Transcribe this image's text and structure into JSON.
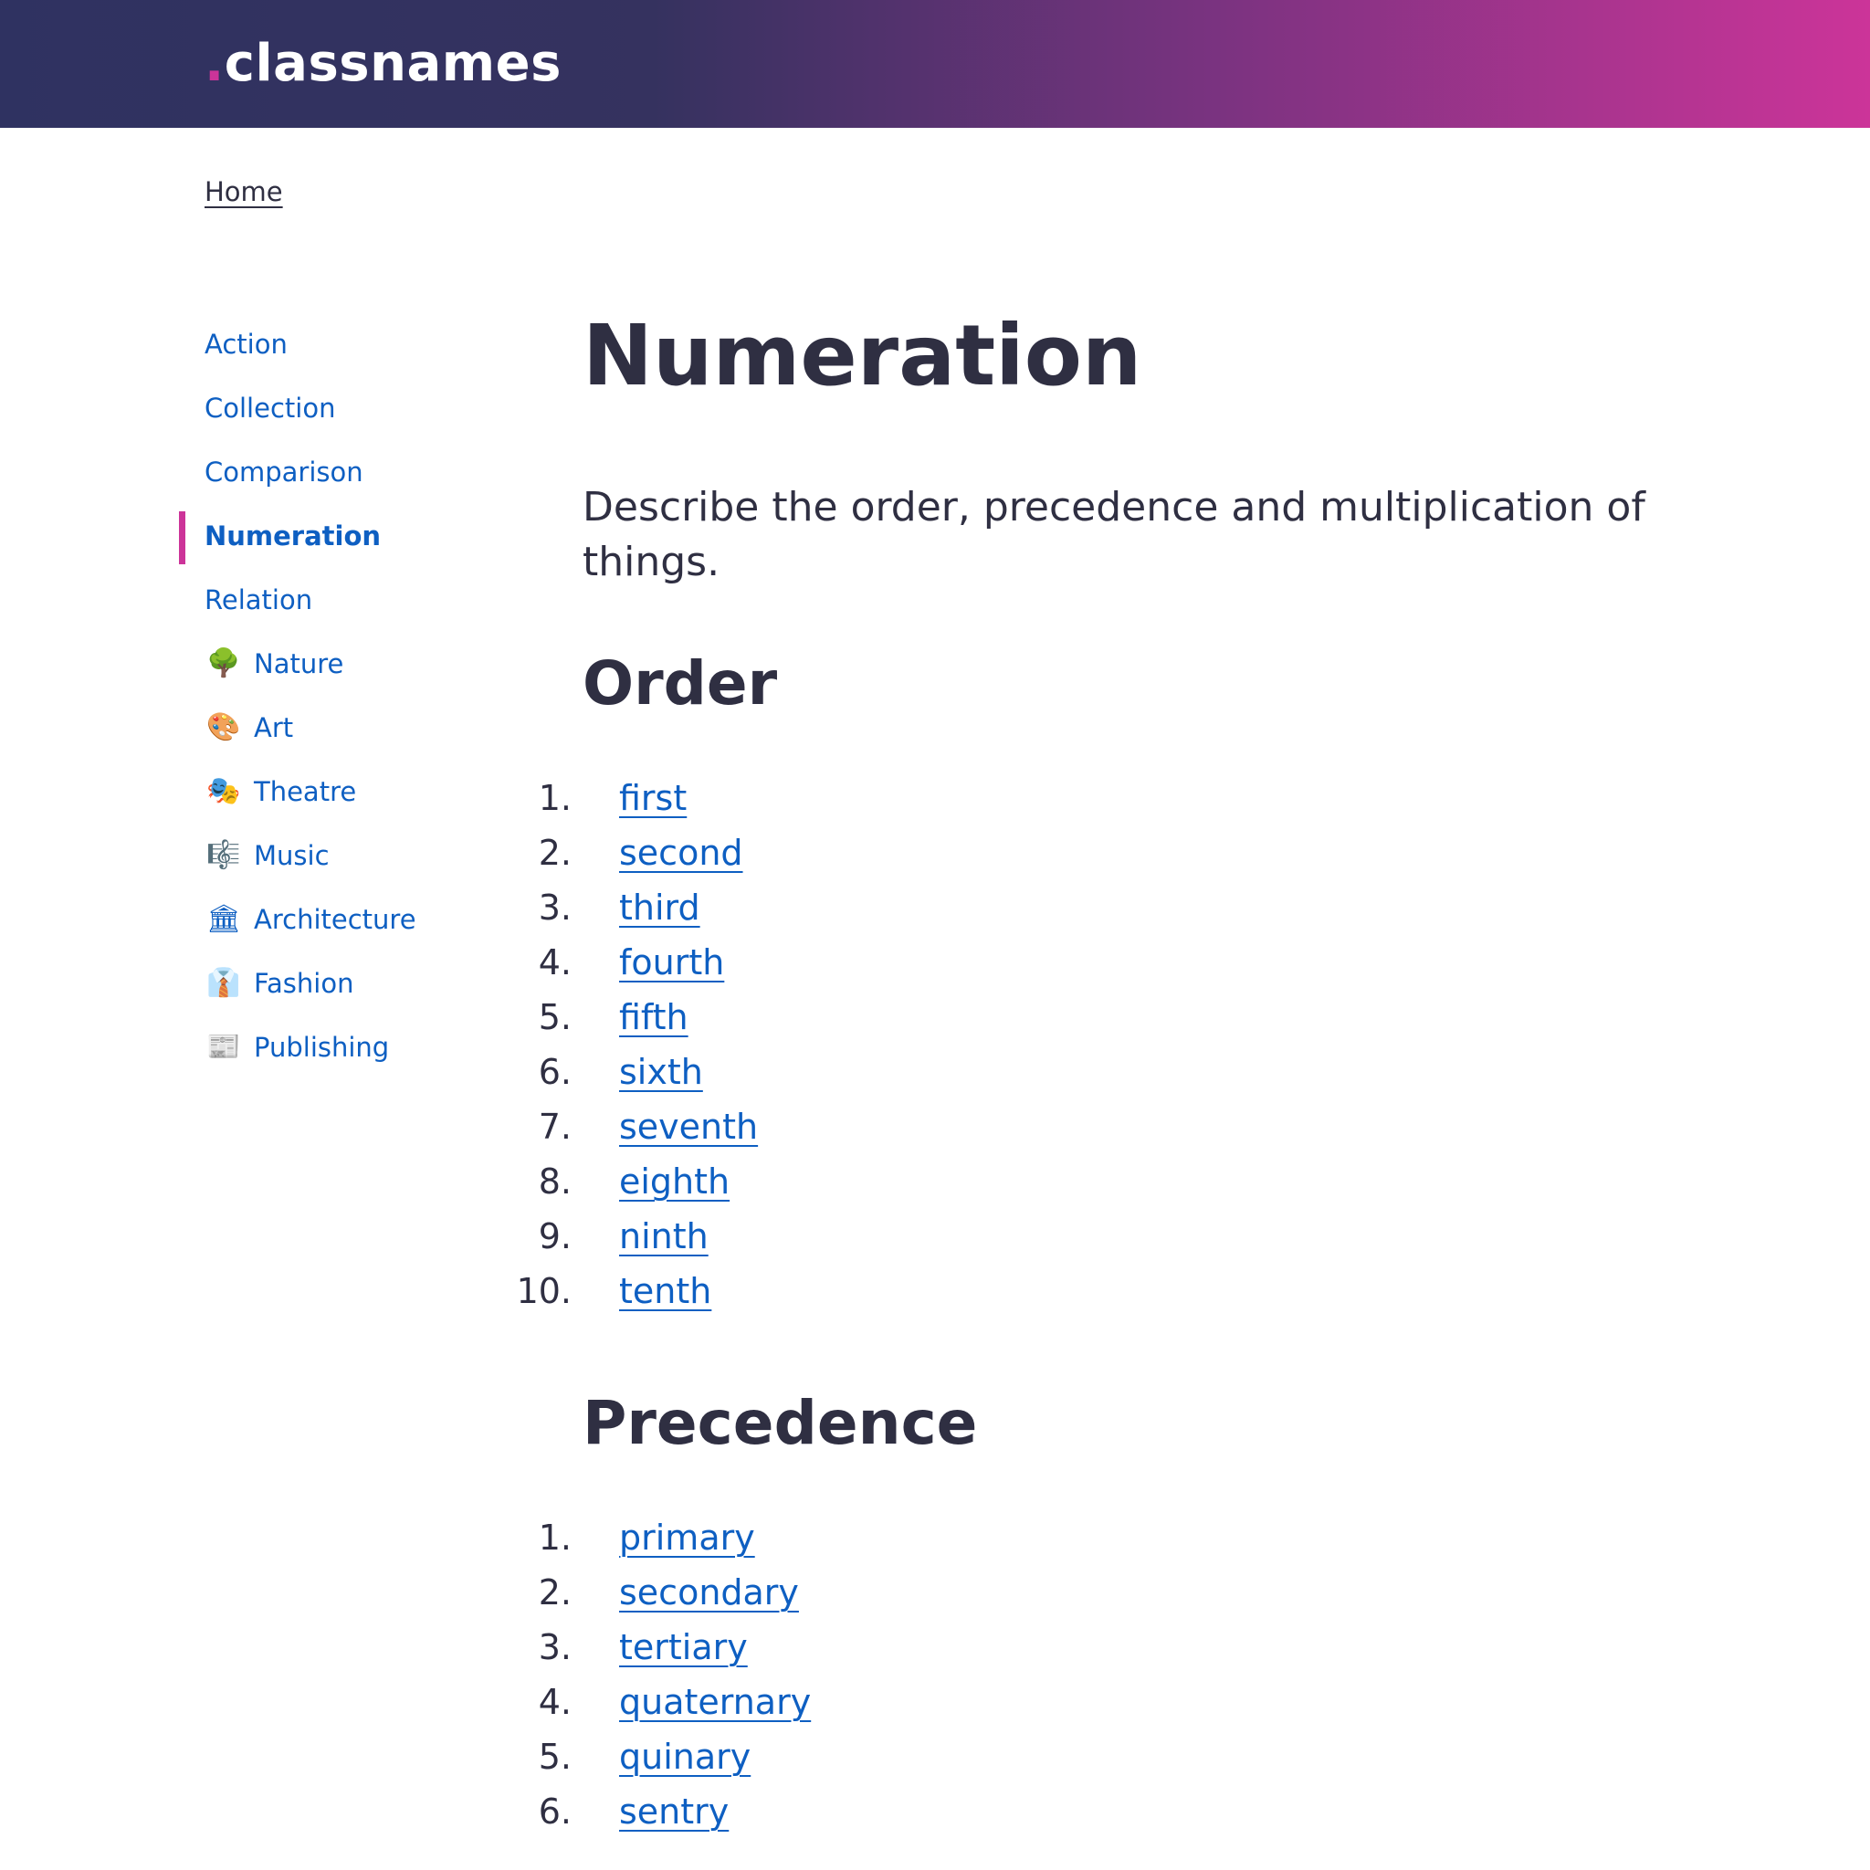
{
  "header": {
    "brand_dot": ".",
    "brand_name": "classnames",
    "gradient_start": "#2f3261",
    "gradient_end": "#cc3499"
  },
  "breadcrumb": {
    "home": "Home"
  },
  "sidebar": {
    "items": [
      {
        "label": "Action",
        "icon": "",
        "active": false
      },
      {
        "label": "Collection",
        "icon": "",
        "active": false
      },
      {
        "label": "Comparison",
        "icon": "",
        "active": false
      },
      {
        "label": "Numeration",
        "icon": "",
        "active": true
      },
      {
        "label": "Relation",
        "icon": "",
        "active": false
      },
      {
        "label": "Nature",
        "icon": "🌳",
        "icon_name": "tree-icon",
        "active": false
      },
      {
        "label": "Art",
        "icon": "🎨",
        "icon_name": "palette-icon",
        "active": false
      },
      {
        "label": "Theatre",
        "icon": "🎭",
        "icon_name": "masks-icon",
        "active": false
      },
      {
        "label": "Music",
        "icon": "🎼",
        "icon_name": "music-score-icon",
        "active": false
      },
      {
        "label": "Architecture",
        "icon": "🏛",
        "icon_name": "classical-building-icon",
        "active": false
      },
      {
        "label": "Fashion",
        "icon": "👔",
        "icon_name": "necktie-icon",
        "active": false
      },
      {
        "label": "Publishing",
        "icon": "📰",
        "icon_name": "newspaper-icon",
        "active": false
      }
    ],
    "active_color": "#cc3499",
    "link_color": "#0e5fc2"
  },
  "main": {
    "title": "Numeration",
    "lead": "Describe the order, precedence and multiplication of things.",
    "sections": [
      {
        "title": "Order",
        "items": [
          "first",
          "second",
          "third",
          "fourth",
          "fifth",
          "sixth",
          "seventh",
          "eighth",
          "ninth",
          "tenth"
        ]
      },
      {
        "title": "Precedence",
        "items": [
          "primary",
          "secondary",
          "tertiary",
          "quaternary",
          "quinary",
          "sentry"
        ]
      }
    ]
  }
}
